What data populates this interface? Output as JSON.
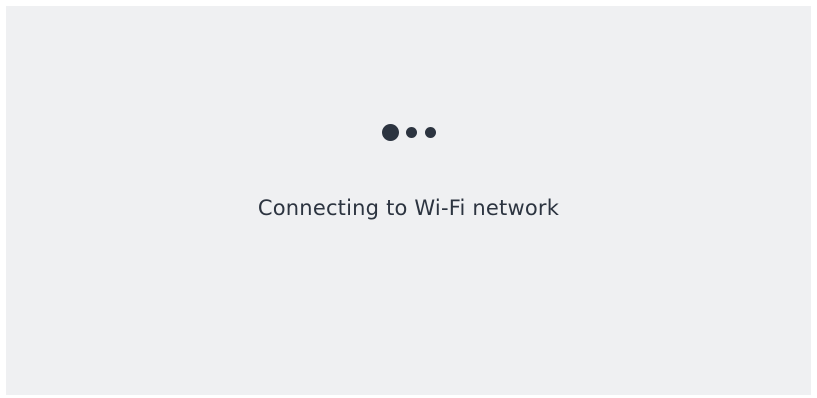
{
  "status": {
    "message": "Connecting to Wi-Fi network",
    "loader_icons": [
      "loading-dot",
      "loading-dot",
      "loading-dot"
    ]
  },
  "colors": {
    "background": "#eff0f2",
    "text": "#2c3440",
    "dot": "#2c3440"
  }
}
